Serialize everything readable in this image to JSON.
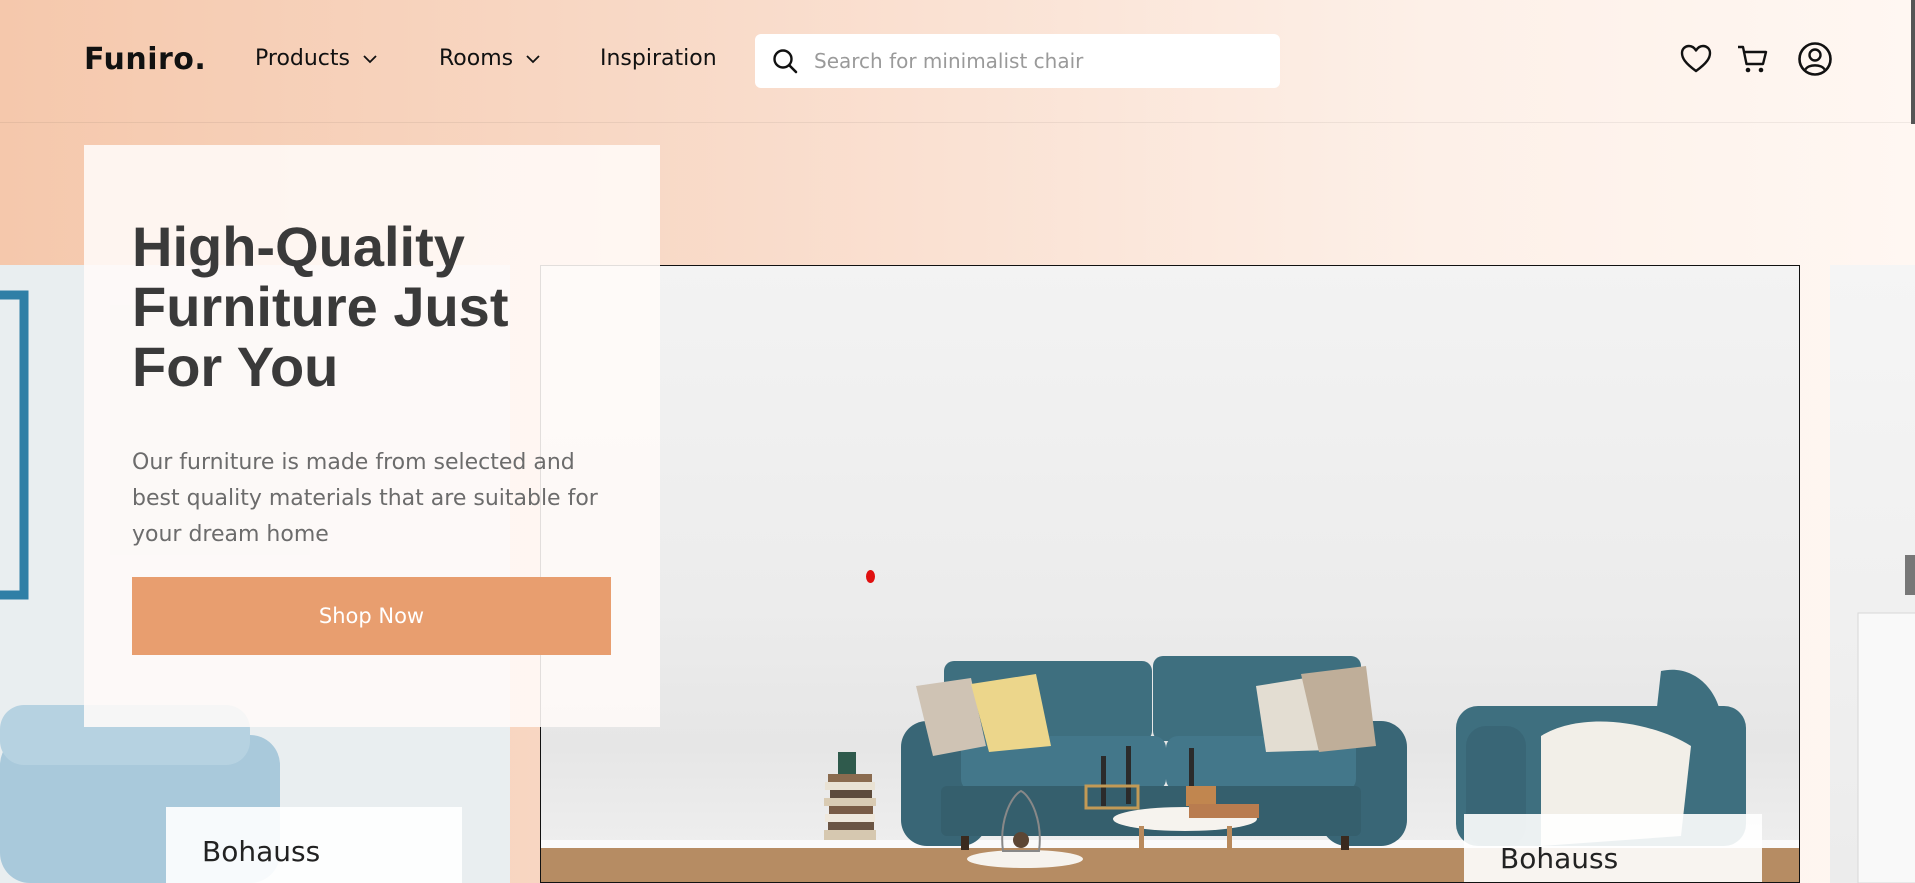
{
  "header": {
    "logo": "Funiro.",
    "nav": [
      {
        "label": "Products",
        "has_dropdown": true
      },
      {
        "label": "Rooms",
        "has_dropdown": true
      },
      {
        "label": "Inspiration",
        "has_dropdown": false
      }
    ],
    "search": {
      "placeholder": "Search for minimalist chair",
      "value": "",
      "icon": "search-icon"
    },
    "icons": [
      "heart-icon",
      "cart-icon",
      "user-icon"
    ]
  },
  "hero": {
    "title": "High-Quality Furniture Just For You",
    "description": "Our furniture is made from selected and best quality materials that are suitable for your dream home",
    "cta_label": "Shop Now"
  },
  "slides": [
    {
      "caption": "Bohauss"
    },
    {
      "caption": "Bohauss"
    }
  ],
  "colors": {
    "accent": "#E89E6F",
    "header_gradient_start": "#F5C8AC",
    "text_dark": "#3A3A3A",
    "text_muted": "#6C6C6C",
    "sofa": "#3E6F7F"
  }
}
